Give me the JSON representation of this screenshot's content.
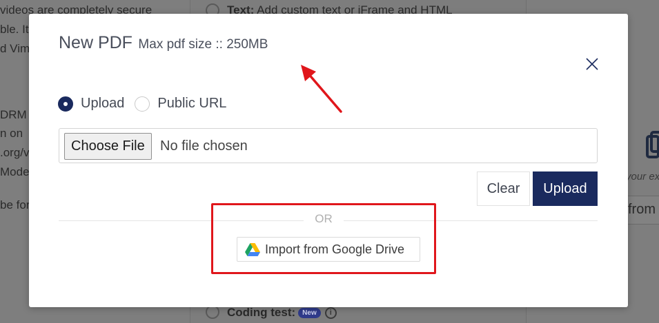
{
  "background": {
    "left_lines": [
      "videos are completely secure",
      "ble. It",
      "d Vime",
      "DRM p",
      "n on",
      ".org/v",
      "Mode",
      "be for"
    ],
    "mid_top": {
      "bold": "Text:",
      "rest": " Add custom text or iFrame and HTML"
    },
    "mid_bottom": {
      "bold": "Coding test:",
      "badge": "New",
      "info": "i"
    },
    "right_texts": [
      "your ex",
      "from"
    ]
  },
  "modal": {
    "title": "New PDF",
    "subtitle": "Max pdf size :: 250MB",
    "close_label": "×",
    "source_options": [
      {
        "label": "Upload",
        "selected": true
      },
      {
        "label": "Public URL",
        "selected": false
      }
    ],
    "file_input": {
      "button_label": "Choose File",
      "status": "No file chosen"
    },
    "clear_label": "Clear",
    "upload_label": "Upload",
    "or_text": "OR",
    "google_drive_label": "Import from Google Drive"
  },
  "colors": {
    "primary": "#1a2a5e",
    "annotation_red": "#e0161b",
    "overlay": "#7d7d7d"
  },
  "icons": [
    "close-icon",
    "google-drive-icon",
    "annotation-arrow",
    "document-icon",
    "info-icon"
  ]
}
